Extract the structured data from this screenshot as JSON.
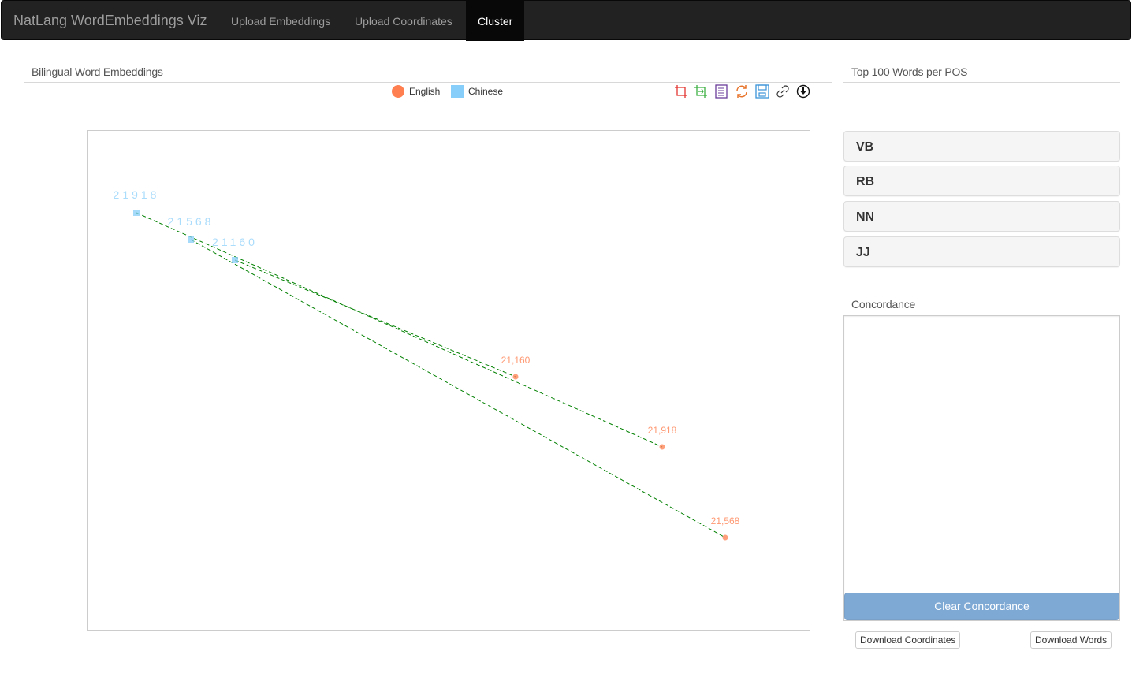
{
  "navbar": {
    "brand": "NatLang WordEmbeddings Viz",
    "items": [
      {
        "label": "Upload Embeddings",
        "active": false
      },
      {
        "label": "Upload Coordinates",
        "active": false
      },
      {
        "label": "Cluster",
        "active": true
      }
    ]
  },
  "main": {
    "title": "Bilingual Word Embeddings",
    "legend": [
      {
        "label": "English",
        "shape": "circle",
        "color": "#ff7f50"
      },
      {
        "label": "Chinese",
        "shape": "square",
        "color": "#87cefa"
      }
    ],
    "toolbox": [
      "data-zoom-icon",
      "data-zoom-reset-icon",
      "data-view-icon",
      "restore-icon",
      "save-image-icon",
      "link-icon",
      "download-icon"
    ]
  },
  "chart_data": {
    "type": "scatter",
    "series": [
      {
        "name": "English",
        "color": "#ff7f50",
        "points": [
          {
            "id": "21,160"
          },
          {
            "id": "21,918"
          },
          {
            "id": "21,568"
          }
        ]
      },
      {
        "name": "Chinese",
        "color": "#87cefa",
        "points": [
          {
            "id": "21918"
          },
          {
            "id": "21568"
          },
          {
            "id": "21160"
          }
        ]
      }
    ],
    "links": [
      {
        "from": "21918",
        "to": "21,918"
      },
      {
        "from": "21568",
        "to": "21,568"
      },
      {
        "from": "21160",
        "to": "21,160"
      }
    ],
    "link_color": "#008000",
    "link_style": "dashed",
    "grid": false
  },
  "sidebar": {
    "title": "Top 100 Words per POS",
    "pos": [
      "VB",
      "RB",
      "NN",
      "JJ"
    ],
    "concordance_title": "Concordance",
    "clear_label": "Clear Concordance",
    "download_coords_label": "Download Coordinates",
    "download_words_label": "Download Words"
  }
}
